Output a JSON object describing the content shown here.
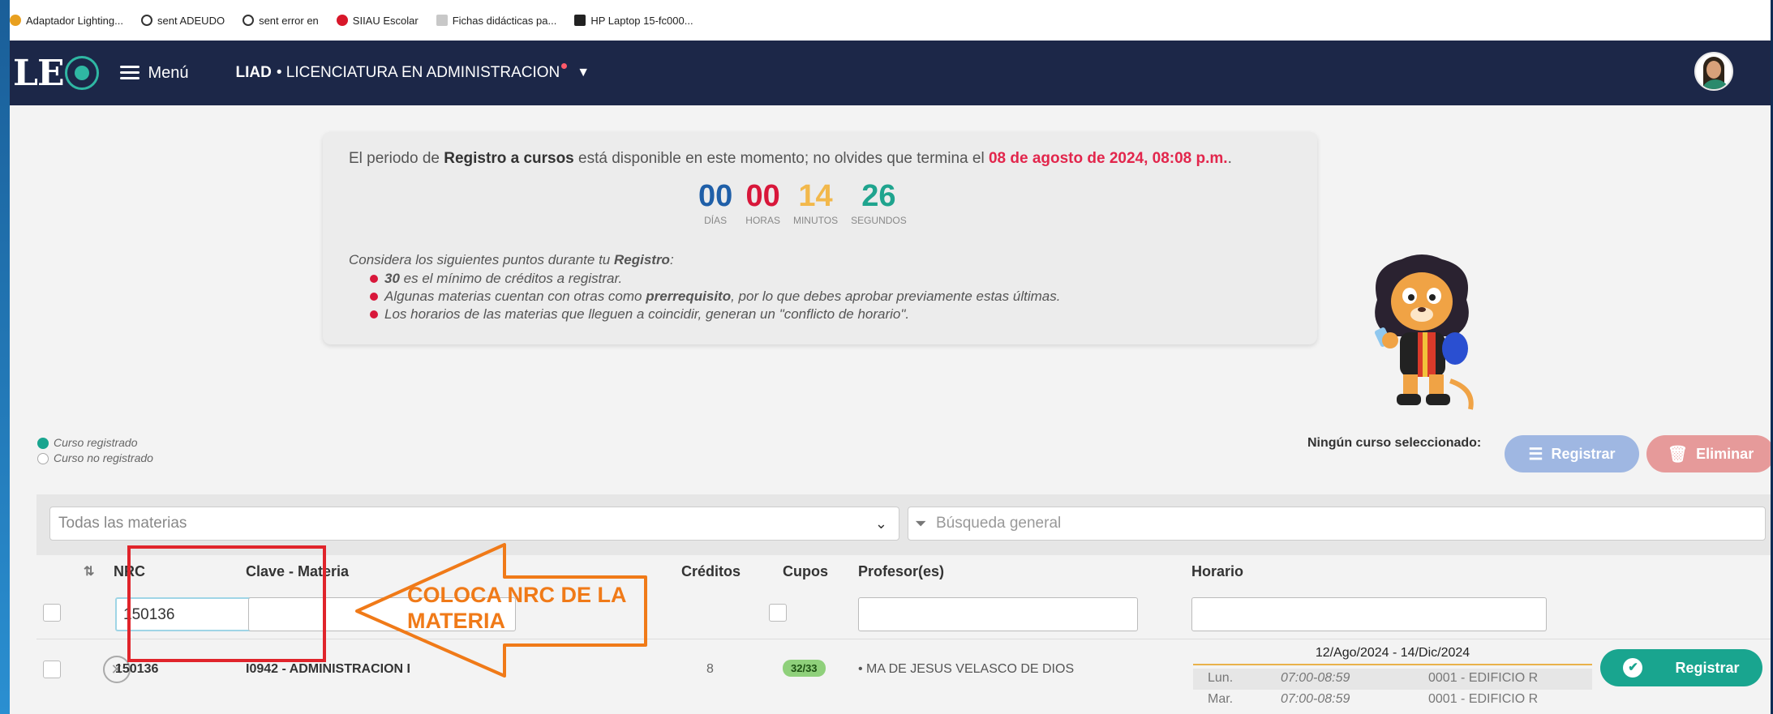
{
  "bookmarks": [
    {
      "label": "Adaptador Lighting...",
      "color": "#e8a020"
    },
    {
      "label": "sent ADEUDO",
      "color": "#333333"
    },
    {
      "label": "sent error en",
      "color": "#333333"
    },
    {
      "label": "SIIAU Escolar",
      "color": "#d8172a"
    },
    {
      "label": "Fichas didácticas pa...",
      "color": "#8a8a8a"
    },
    {
      "label": "HP Laptop 15-fc000...",
      "color": "#f0a020"
    }
  ],
  "nav": {
    "logo": "LE",
    "menu_label": "Menú",
    "program_code": "LIAD",
    "program_name": "• LICENCIATURA EN ADMINISTRACION"
  },
  "announcement": {
    "prefix": "El periodo de ",
    "bold": "Registro a cursos",
    "middle": " está disponible en este momento; no olvides que termina el ",
    "date": "08 de agosto de 2024, 08:08 p.m.",
    "suffix": ".",
    "countdown": [
      {
        "value": "00",
        "label": "DÍAS",
        "color": "#1f5fa8"
      },
      {
        "value": "00",
        "label": "HORAS",
        "color": "#d8173a"
      },
      {
        "value": "14",
        "label": "MINUTOS",
        "color": "#f2b84b"
      },
      {
        "value": "26",
        "label": "SEGUNDOS",
        "color": "#1fa48e"
      }
    ],
    "tips_intro": "Considera los siguientes puntos durante tu ",
    "tips_intro_bold": "Registro",
    "tips_intro_end": ":",
    "tips": [
      {
        "bold": "30",
        "text": " es el mínimo de créditos a registrar.",
        "bold_after": "",
        "end": ""
      },
      {
        "bold": "",
        "text": "Algunas materias cuentan con otras como ",
        "bold_after": "prerrequisito",
        "end": ", por lo que debes aprobar previamente estas últimas."
      },
      {
        "bold": "",
        "text": "Los horarios de las materias que lleguen a coincidir, generan un \"conflicto de horario\".",
        "bold_after": "",
        "end": ""
      }
    ]
  },
  "legend": {
    "registered": "Curso registrado",
    "not_registered": "Curso no registrado"
  },
  "actions": {
    "none_selected": "Ningún curso seleccionado:",
    "register": "Registrar",
    "delete": "Eliminar"
  },
  "filters": {
    "materias": "Todas las materias",
    "search_placeholder": "Búsqueda general"
  },
  "table": {
    "headers": {
      "nrc": "NRC",
      "clave": "Clave - Materia",
      "creditos": "Créditos",
      "cupos": "Cupos",
      "profesor": "Profesor(es)",
      "horario": "Horario"
    },
    "nrc_filter_value": "150136",
    "rows": [
      {
        "nrc": "150136",
        "clave": "I0942 - ADMINISTRACION I",
        "creditos": "8",
        "cupos": "32/33",
        "profesor": "• MA DE JESUS VELASCO DE DIOS",
        "periodo": "12/Ago/2024 - 14/Dic/2024",
        "horarios": [
          {
            "dia": "Lun.",
            "hora": "07:00-08:59",
            "aula": "0001 - EDIFICIO R"
          },
          {
            "dia": "Mar.",
            "hora": "07:00-08:59",
            "aula": "0001 - EDIFICIO R"
          }
        ],
        "button": "Registrar"
      }
    ]
  },
  "annotation": {
    "text_line1": "COLOCA NRC DE LA",
    "text_line2": "MATERIA",
    "color": "#f07a18",
    "box_color": "#e0242b"
  }
}
